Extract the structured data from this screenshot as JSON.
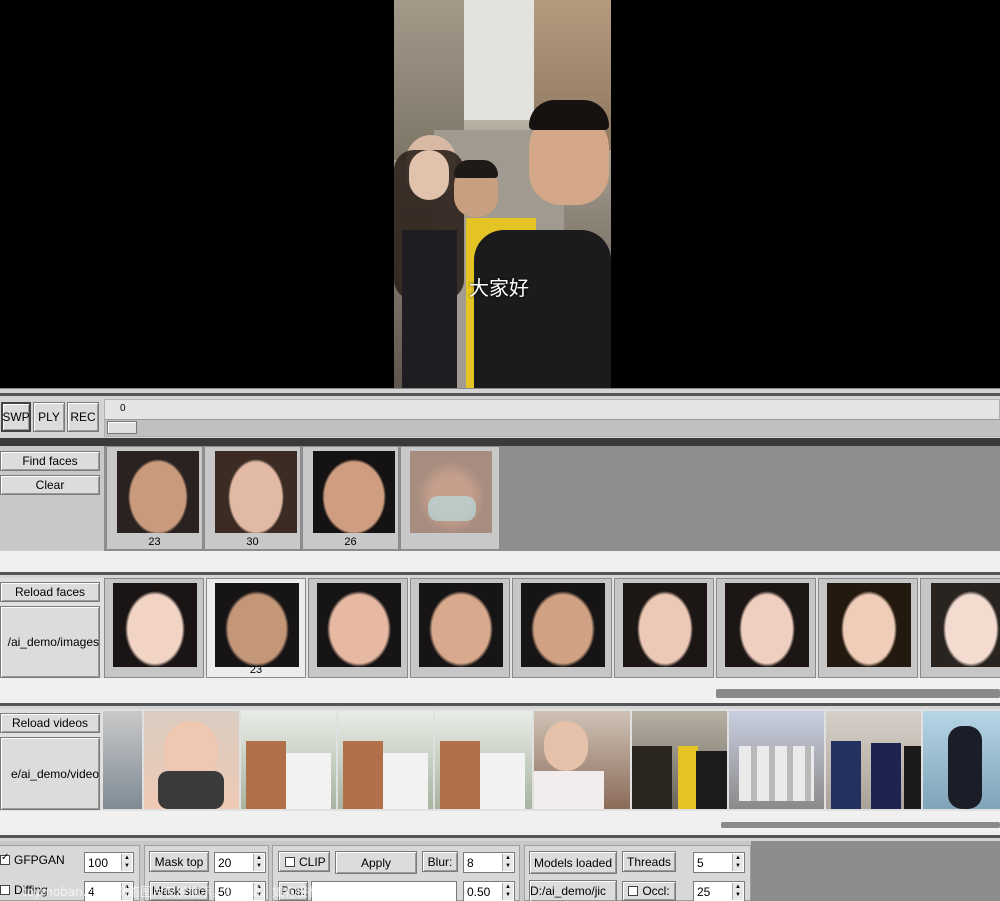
{
  "video": {
    "subtitle": "大家好"
  },
  "player": {
    "swap_label": "SWP",
    "play_label": "PLY",
    "record_label": "REC",
    "frame_value": "0"
  },
  "found_faces": {
    "find_label": "Find faces",
    "clear_label": "Clear",
    "items": [
      {
        "count": "23"
      },
      {
        "count": "30"
      },
      {
        "count": "26"
      },
      {
        "count": ""
      }
    ]
  },
  "source_faces": {
    "reload_label": "Reload faces",
    "folder": "/ai_demo/images",
    "items": [
      {
        "count": ""
      },
      {
        "count": "23"
      },
      {
        "count": ""
      },
      {
        "count": ""
      },
      {
        "count": ""
      },
      {
        "count": ""
      },
      {
        "count": ""
      },
      {
        "count": ""
      },
      {
        "count": ""
      }
    ]
  },
  "videos": {
    "reload_label": "Reload videos",
    "folder": "e/ai_demo/video"
  },
  "options": {
    "gfpgan_label": "GFPGAN",
    "gfpgan_value": "100",
    "diffing_label": "Diffing",
    "diffing_value": "4",
    "mask_top_label": "Mask top",
    "mask_top_value": "20",
    "mask_side_label": "Mask side",
    "mask_side_value": "50",
    "clip_label": "CLIP",
    "apply_label": "Apply",
    "blur_label": "Blur:",
    "blur_value": "8",
    "pos_label": "Pos:",
    "pos_value": "0.50",
    "models_label": "Models loaded",
    "path_label": "D:/ai_demo/jic",
    "threads_label": "Threads",
    "threads_value": "5",
    "occl_label": "Occl:",
    "occl_value": "25"
  },
  "watermark": "toymoban.com 网络图片仅供展示，非存储，如有侵权请联系删除。",
  "colors": {
    "panel": "#d4d4d4",
    "dark_panel": "#8c8c8c",
    "video_bg": "#000000",
    "found_strip": "#8e8e8e",
    "source_strip": "#e0e0e0"
  }
}
